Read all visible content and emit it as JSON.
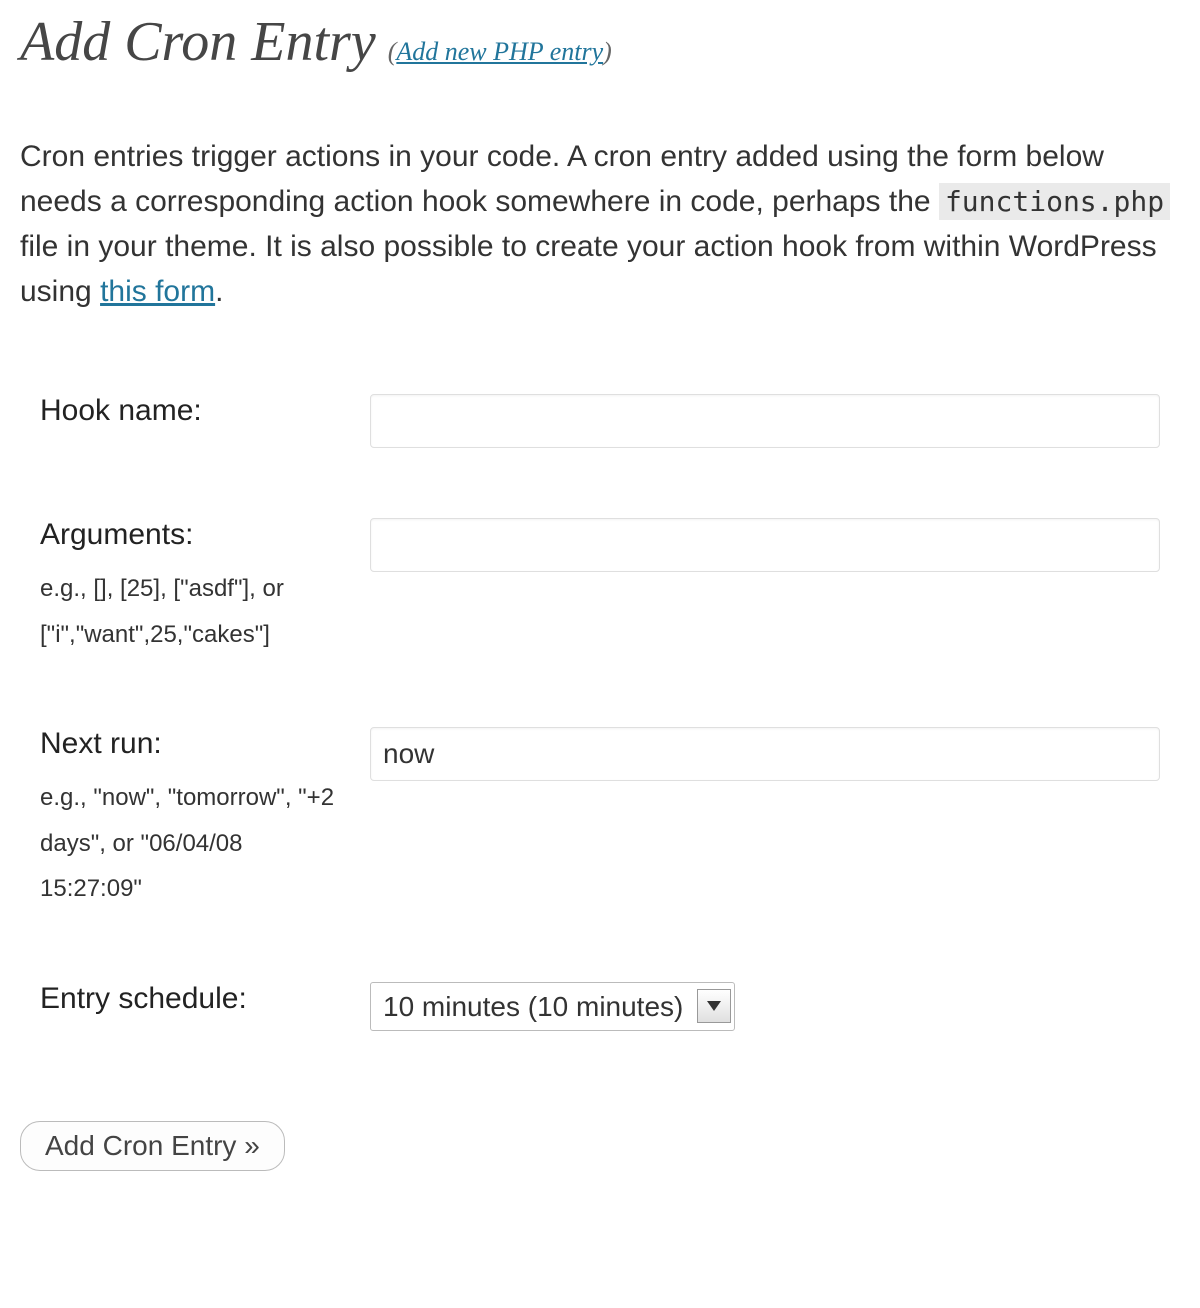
{
  "header": {
    "title": "Add Cron Entry",
    "sublink_prefix": "(",
    "sublink_text": "Add new PHP entry",
    "sublink_suffix": ")"
  },
  "description": {
    "text_before_code": "Cron entries trigger actions in your code. A cron entry added using the form below needs a corresponding action hook somewhere in code, perhaps the ",
    "code_text": "functions.php",
    "text_after_code": " file in your theme. It is also possible to create your action hook from within WordPress using ",
    "link_text": "this form",
    "text_after_link": "."
  },
  "form": {
    "hook_name": {
      "label": "Hook name:",
      "value": ""
    },
    "arguments": {
      "label": "Arguments:",
      "hint": "e.g., [], [25], [\"asdf\"], or [\"i\",\"want\",25,\"cakes\"]",
      "value": ""
    },
    "next_run": {
      "label": "Next run:",
      "hint": "e.g., \"now\", \"tomorrow\", \"+2 days\", or \"06/04/08 15:27:09\"",
      "value": "now"
    },
    "entry_schedule": {
      "label": "Entry schedule:",
      "selected": "10 minutes (10 minutes)"
    },
    "submit_label": "Add Cron Entry »"
  }
}
